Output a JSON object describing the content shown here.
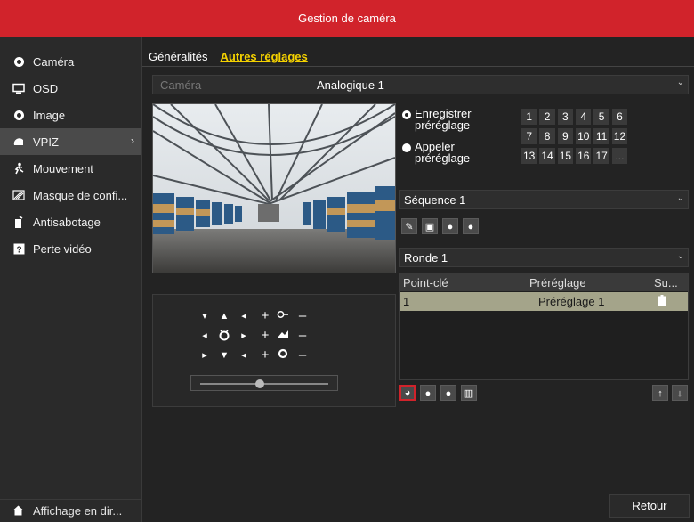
{
  "title": "Gestion de caméra",
  "sidebar": {
    "items": [
      {
        "label": "Caméra",
        "icon": "camera-icon"
      },
      {
        "label": "OSD",
        "icon": "monitor-icon"
      },
      {
        "label": "Image",
        "icon": "image-icon"
      },
      {
        "label": "VPIZ",
        "icon": "ptz-icon",
        "active": true
      },
      {
        "label": "Mouvement",
        "icon": "motion-icon"
      },
      {
        "label": "Masque de confi...",
        "icon": "privacy-mask-icon"
      },
      {
        "label": "Antisabotage",
        "icon": "tamper-icon"
      },
      {
        "label": "Perte vidéo",
        "icon": "video-loss-icon"
      }
    ],
    "bottom_label": "Affichage en dir..."
  },
  "tabs": [
    "Généralités",
    "Autres réglages"
  ],
  "camera": {
    "label": "Caméra",
    "value": "Analogique 1"
  },
  "preset": {
    "save_label": "Enregistrer préréglage",
    "call_label": "Appeler préréglage",
    "numbers": [
      "1",
      "2",
      "3",
      "4",
      "5",
      "6",
      "7",
      "8",
      "9",
      "10",
      "11",
      "12",
      "13",
      "14",
      "15",
      "16",
      "17",
      "..."
    ]
  },
  "sequence": {
    "value": "Séquence 1"
  },
  "ronde": {
    "value": "Ronde 1"
  },
  "table": {
    "headers": [
      "Point-clé",
      "Préréglage",
      "Su..."
    ],
    "rows": [
      {
        "point": "1",
        "preset": "Préréglage 1"
      }
    ]
  },
  "back_label": "Retour",
  "colors": {
    "titlebar": "#d1232b",
    "active_tab": "#f5d200",
    "selected_row": "#a4a48a"
  }
}
